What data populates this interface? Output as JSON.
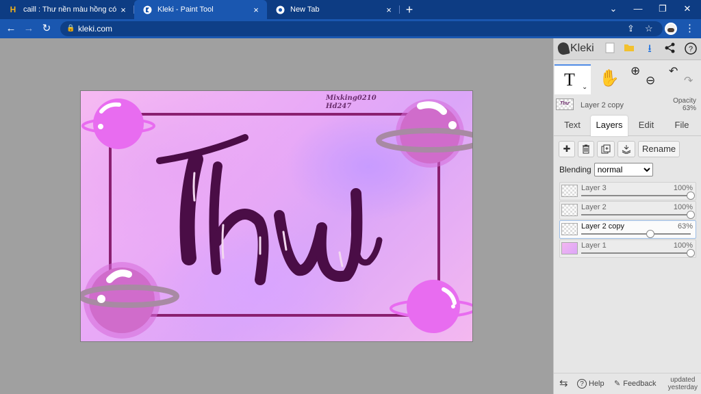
{
  "browser": {
    "tabs": [
      {
        "title": "caill : Thư nền màu hồng có tâm",
        "favicon": "H",
        "close": "×"
      },
      {
        "title": "Kleki - Paint Tool",
        "favicon": "kleki-icon",
        "close": "×"
      },
      {
        "title": "New Tab",
        "favicon": "chrome-icon",
        "close": "×"
      }
    ],
    "new_tab": "+",
    "url": "kleki.com"
  },
  "canvas": {
    "credit_line1": "Mixking0210",
    "credit_line2": "Hd247",
    "artwork_text": "Thư"
  },
  "panel": {
    "logo_text": "Kleki",
    "current_layer": {
      "name": "Layer 2 copy",
      "opacity_label": "Opacity",
      "opacity_value": "63%"
    },
    "tool_text_glyph": "T",
    "tabs": [
      "Text",
      "Layers",
      "Edit",
      "File"
    ],
    "active_tab": "Layers",
    "rename_label": "Rename",
    "blending_label": "Blending",
    "blending_value": "normal",
    "layers": [
      {
        "name": "Layer 3",
        "opacity": "100%",
        "fraction": 1.0,
        "selected": false
      },
      {
        "name": "Layer 2",
        "opacity": "100%",
        "fraction": 1.0,
        "selected": false
      },
      {
        "name": "Layer 2 copy",
        "opacity": "63%",
        "fraction": 0.63,
        "selected": true
      },
      {
        "name": "Layer 1",
        "opacity": "100%",
        "fraction": 1.0,
        "selected": false
      }
    ],
    "footer": {
      "help": "Help",
      "feedback": "Feedback",
      "updated_line1": "updated",
      "updated_line2": "yesterday"
    }
  },
  "colors": {
    "tabstrip": "#0d3c83",
    "omnibar": "#1a57b0",
    "frame": "#8a1f70",
    "letters": "#4a0d46",
    "planet": "#e86cf0"
  }
}
